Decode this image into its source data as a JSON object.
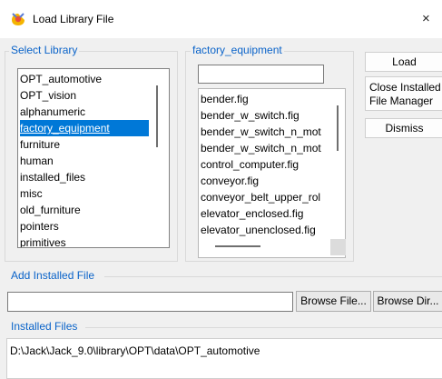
{
  "window": {
    "title": "Load Library File",
    "close_glyph": "×",
    "icon": "jack-app-icon"
  },
  "select_library": {
    "legend": "Select Library",
    "items": [
      "OPT_automotive",
      "OPT_vision",
      "alphanumeric",
      "factory_equipment",
      "furniture",
      "human",
      "installed_files",
      "misc",
      "old_furniture",
      "pointers",
      "primitives"
    ],
    "selected": "factory_equipment"
  },
  "factory_equipment": {
    "legend": "factory_equipment",
    "filter_value": "",
    "files": [
      "bender.fig",
      "bender_w_switch.fig",
      "bender_w_switch_n_mot",
      "bender_w_switch_n_mot",
      "control_computer.fig",
      "conveyor.fig",
      "conveyor_belt_upper_rol",
      "elevator_enclosed.fig",
      "elevator_unenclosed.fig"
    ]
  },
  "buttons": {
    "load": "Load",
    "close_line1": "Close Installed",
    "close_line2": "File Manager",
    "dismiss": "Dismiss",
    "browse_file": "Browse File...",
    "browse_dir": "Browse Dir..."
  },
  "add_installed": {
    "legend": "Add Installed File",
    "value": ""
  },
  "installed_files": {
    "legend": "Installed Files",
    "path": "D:\\Jack\\Jack_9.0\\library\\OPT\\data\\OPT_automotive"
  },
  "colors": {
    "accent": "#0a63c9",
    "selection": "#0078d7"
  }
}
